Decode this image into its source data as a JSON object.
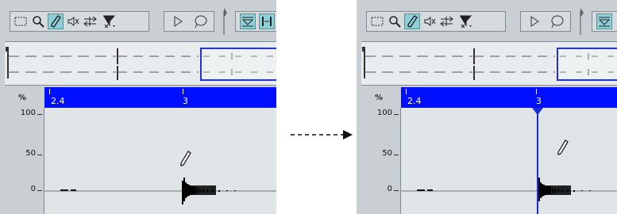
{
  "ruler": {
    "corner_label": "%",
    "left_position": "2.4",
    "bar_position": "3"
  },
  "y_axis": {
    "labels": [
      "100",
      "50",
      "0"
    ]
  },
  "toolbar": {
    "tools": [
      "range-select",
      "zoom",
      "draw",
      "mute",
      "time-warp",
      "quantize",
      "play",
      "loop",
      "auto-scroll",
      "snap"
    ],
    "active_tool": "draw"
  },
  "colors": {
    "ruler": "#0010ff",
    "editor_bg": "#dfe5e6",
    "panel_bg": "#c9cfd3",
    "active_tool": "#8fd0d8",
    "cursor": "#1a2bd8"
  },
  "icons": {
    "range_select": "dotted-rectangle-icon",
    "zoom": "magnifier-icon",
    "draw": "pencil-icon",
    "mute": "speaker-mute-icon",
    "time_warp": "warp-arrows-icon",
    "quantize": "quantize-icon",
    "play": "play-triangle-icon",
    "loop": "loop-lasso-icon",
    "auto_scroll": "auto-scroll-icon"
  }
}
